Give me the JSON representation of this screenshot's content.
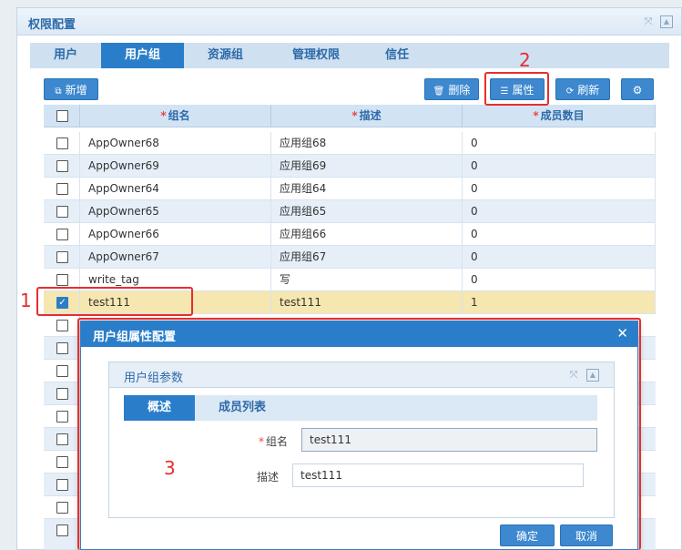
{
  "panel": {
    "title": "权限配置"
  },
  "tabs": [
    {
      "label": "用户",
      "active": false
    },
    {
      "label": "用户组",
      "active": true
    },
    {
      "label": "资源组",
      "active": false
    },
    {
      "label": "管理权限",
      "active": false
    },
    {
      "label": "信任",
      "active": false
    }
  ],
  "toolbar": {
    "add_label": "新增",
    "delete_label": "删除",
    "properties_label": "属性",
    "refresh_label": "刷新"
  },
  "grid": {
    "columns": [
      "组名",
      "描述",
      "成员数目"
    ],
    "rows": [
      {
        "name": "AppOwner68",
        "desc": "应用组68",
        "count": "0",
        "checked": false
      },
      {
        "name": "AppOwner69",
        "desc": "应用组69",
        "count": "0",
        "checked": false
      },
      {
        "name": "AppOwner64",
        "desc": "应用组64",
        "count": "0",
        "checked": false
      },
      {
        "name": "AppOwner65",
        "desc": "应用组65",
        "count": "0",
        "checked": false
      },
      {
        "name": "AppOwner66",
        "desc": "应用组66",
        "count": "0",
        "checked": false
      },
      {
        "name": "AppOwner67",
        "desc": "应用组67",
        "count": "0",
        "checked": false
      },
      {
        "name": "write_tag",
        "desc": "写",
        "count": "0",
        "checked": false
      },
      {
        "name": "test111",
        "desc": "test111",
        "count": "1",
        "checked": true
      }
    ]
  },
  "annotations": {
    "m1": "1",
    "m2": "2",
    "m3": "3"
  },
  "dialog": {
    "title": "用户组属性配置",
    "panel_title": "用户组参数",
    "tabs": [
      {
        "label": "概述",
        "active": true
      },
      {
        "label": "成员列表",
        "active": false
      }
    ],
    "name_label": "组名",
    "name_value": "test111",
    "desc_label": "描述",
    "desc_value": "test111",
    "ok_label": "确定",
    "cancel_label": "取消"
  },
  "colors": {
    "accent": "#2a7ec9",
    "annotation": "#e62e2e",
    "selected_row": "#f6e6b0"
  }
}
